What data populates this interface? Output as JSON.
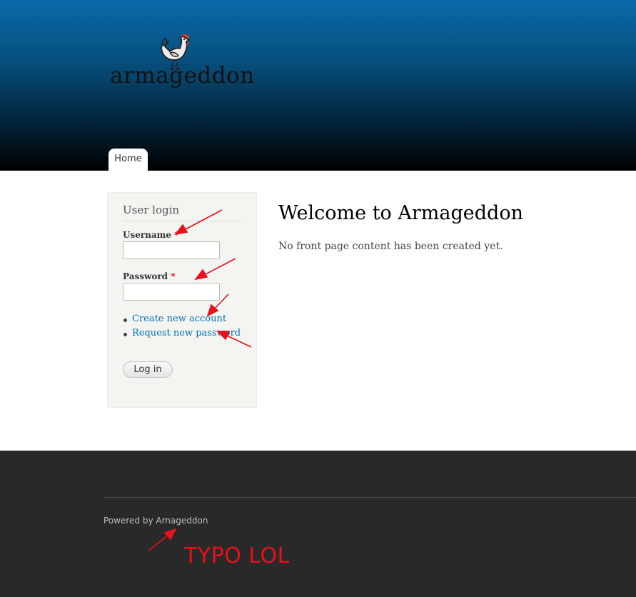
{
  "header": {
    "site_name": "armageddon",
    "logo_icon": "chicken-icon",
    "nav": {
      "home_label": "Home"
    }
  },
  "sidebar": {
    "login": {
      "title": "User login",
      "username_label": "Username",
      "password_label": "Password",
      "required_marker": "*",
      "username_value": "",
      "password_value": "",
      "links": [
        {
          "label": "Create new account"
        },
        {
          "label": "Request new password"
        }
      ],
      "submit_label": "Log in"
    }
  },
  "main": {
    "title": "Welcome to Armageddon",
    "body": "No front page content has been created yet."
  },
  "footer": {
    "powered_by": "Powered by Arnageddon",
    "annotation": "TYPO LOL"
  },
  "colors": {
    "header_top": "#0a6aa8",
    "header_bottom": "#000000",
    "link": "#0071b3",
    "required": "#e00000",
    "annotation": "#e8101a",
    "footer_bg": "#292929",
    "sidebar_bg": "#f4f4f0"
  }
}
